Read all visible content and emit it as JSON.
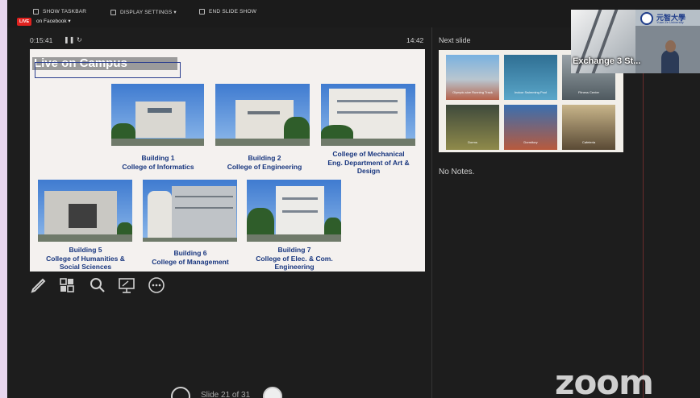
{
  "taskbar": {
    "show_taskbar": "SHOW TASKBAR",
    "display_settings": "DISPLAY SETTINGS ▾",
    "end_show": "END SLIDE SHOW"
  },
  "live": {
    "badge": "LIVE",
    "destination": "on Facebook ▾"
  },
  "presenter": {
    "timer": "0:15:41",
    "pause_icon": "pause-icon",
    "restart_icon": "restart-icon",
    "clock": "14:42",
    "next_slide_label": "Next slide",
    "notes": "No Notes.",
    "slide_counter": "Slide 21 of 31"
  },
  "slide": {
    "title": "Live on Campus",
    "buildings": [
      {
        "name": "Building 1",
        "college": "College of Informatics"
      },
      {
        "name": "Building 2",
        "college": "College of Engineering"
      },
      {
        "name": "",
        "college": "College of Mechanical Eng. Department of Art & Design"
      },
      {
        "name": "Building 5",
        "college": "College of Humanities & Social Sciences"
      },
      {
        "name": "Building 6",
        "college": "College of Management"
      },
      {
        "name": "Building 7",
        "college": "College of Elec. & Com. Engineering"
      }
    ]
  },
  "next_slide_thumbs": [
    "Olympic-size Running Track",
    "Indoor Swimming Pool",
    "Fitness Center",
    "Dorms",
    "Dormitory",
    "Cafeteria"
  ],
  "tools": [
    "pen-icon",
    "slide-grid-icon",
    "zoom-icon",
    "pointer-screen-icon",
    "more-icon"
  ],
  "video": {
    "participant": "Exchange 3 St...",
    "university": "元智大學",
    "university_en": "Yuan Ze University"
  },
  "branding": {
    "zoom": "zoom"
  },
  "colors": {
    "live": "#e0221f",
    "slide_caption": "#17357e",
    "background": "#1d1d1d"
  }
}
